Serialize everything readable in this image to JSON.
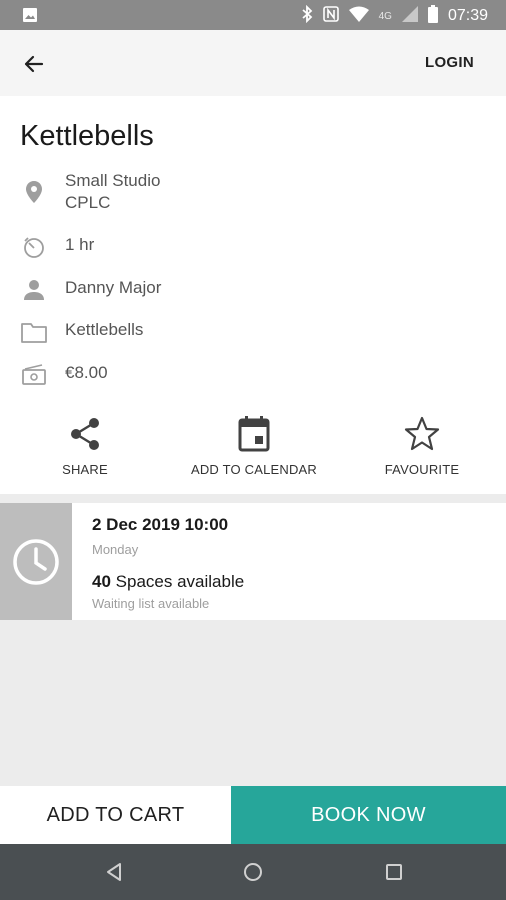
{
  "status_bar": {
    "time": "07:39",
    "network": "4G",
    "icons": [
      "image-icon",
      "bluetooth-icon",
      "nfc-icon",
      "wifi-icon",
      "signal-icon",
      "battery-icon"
    ]
  },
  "app_bar": {
    "login_label": "LOGIN",
    "back_icon": "arrow-back-icon"
  },
  "class": {
    "title": "Kettlebells",
    "location_line1": "Small Studio",
    "location_line2": "CPLC",
    "duration": "1 hr",
    "instructor": "Danny Major",
    "category": "Kettlebells",
    "price": "€8.00"
  },
  "actions": {
    "share_label": "SHARE",
    "calendar_label": "ADD TO CALENDAR",
    "favourite_label": "FAVOURITE"
  },
  "session": {
    "date": "2 Dec 2019 10:00",
    "day": "Monday",
    "spaces_count": "40",
    "spaces_text": " Spaces available",
    "waiting": "Waiting list available"
  },
  "bottom": {
    "add_to_cart": "ADD TO CART",
    "book_now": "BOOK NOW"
  },
  "colors": {
    "accent": "#26a69a",
    "status_bar": "#8a8a8a",
    "nav_bar": "#4a4f52",
    "clock_box": "#bdbdbd"
  }
}
